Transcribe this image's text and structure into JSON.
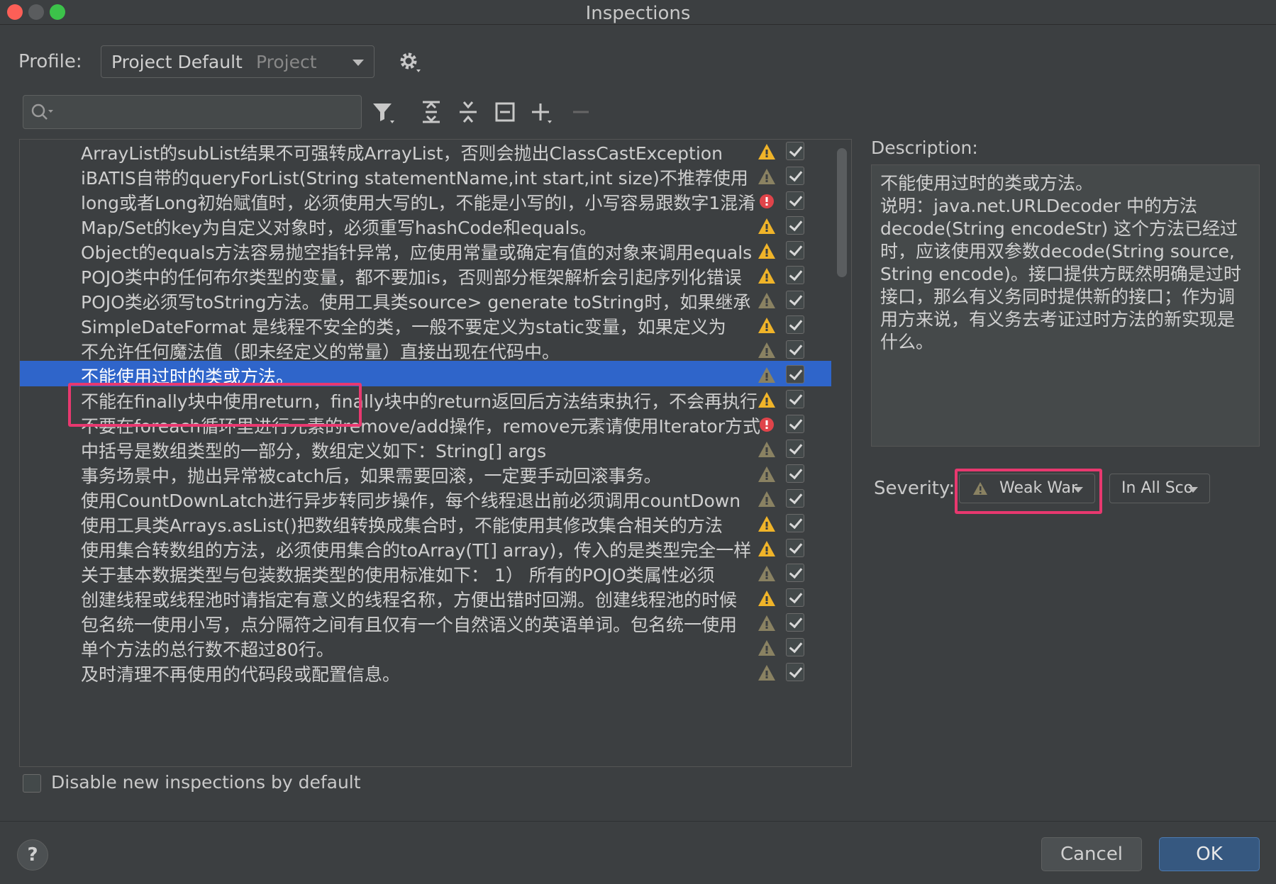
{
  "window": {
    "title": "Inspections"
  },
  "profile": {
    "label": "Profile:",
    "value": "Project Default",
    "scope": "Project"
  },
  "search": {
    "placeholder": ""
  },
  "inspections": [
    {
      "text": "ArrayList的subList结果不可强转成ArrayList，否则会抛出ClassCastException",
      "severity": "warning",
      "checked": true
    },
    {
      "text": "iBATIS自带的queryForList(String statementName,int start,int size)不推荐使用",
      "severity": "weak-warning",
      "checked": true
    },
    {
      "text": "long或者Long初始赋值时，必须使用大写的L，不能是小写的l，小写容易跟数字1混淆",
      "severity": "error",
      "checked": true
    },
    {
      "text": "Map/Set的key为自定义对象时，必须重写hashCode和equals。",
      "severity": "warning",
      "checked": true
    },
    {
      "text": "Object的equals方法容易抛空指针异常，应使用常量或确定有值的对象来调用equals",
      "severity": "warning",
      "checked": true
    },
    {
      "text": "POJO类中的任何布尔类型的变量，都不要加is，否则部分框架解析会引起序列化错误",
      "severity": "warning",
      "checked": true
    },
    {
      "text": "POJO类必须写toString方法。使用工具类source> generate toString时，如果继承",
      "severity": "weak-warning",
      "checked": true
    },
    {
      "text": "SimpleDateFormat 是线程不安全的类，一般不要定义为static变量，如果定义为",
      "severity": "warning",
      "checked": true
    },
    {
      "text": "不允许任何魔法值（即未经定义的常量）直接出现在代码中。",
      "severity": "weak-warning",
      "checked": true
    },
    {
      "text": "不能使用过时的类或方法。",
      "severity": "weak-warning",
      "checked": true,
      "selected": true
    },
    {
      "text": "不能在finally块中使用return，finally块中的return返回后方法结束执行，不会再执行",
      "severity": "warning",
      "checked": true
    },
    {
      "text": "不要在foreach循环里进行元素的remove/add操作，remove元素请使用Iterator方式",
      "severity": "error",
      "checked": true
    },
    {
      "text": "中括号是数组类型的一部分，数组定义如下：String[] args",
      "severity": "weak-warning",
      "checked": true
    },
    {
      "text": "事务场景中，抛出异常被catch后，如果需要回滚，一定要手动回滚事务。",
      "severity": "weak-warning",
      "checked": true
    },
    {
      "text": "使用CountDownLatch进行异步转同步操作，每个线程退出前必须调用countDown",
      "severity": "weak-warning",
      "checked": true
    },
    {
      "text": "使用工具类Arrays.asList()把数组转换成集合时，不能使用其修改集合相关的方法",
      "severity": "warning",
      "checked": true
    },
    {
      "text": "使用集合转数组的方法，必须使用集合的toArray(T[] array)，传入的是类型完全一样",
      "severity": "warning",
      "checked": true
    },
    {
      "text": "关于基本数据类型与包装数据类型的使用标准如下：    1） 所有的POJO类属性必须",
      "severity": "weak-warning",
      "checked": true
    },
    {
      "text": "创建线程或线程池时请指定有意义的线程名称，方便出错时回溯。创建线程池的时候",
      "severity": "warning",
      "checked": true
    },
    {
      "text": "包名统一使用小写，点分隔符之间有且仅有一个自然语义的英语单词。包名统一使用",
      "severity": "weak-warning",
      "checked": true
    },
    {
      "text": "单个方法的总行数不超过80行。",
      "severity": "weak-warning",
      "checked": true
    },
    {
      "text": "及时清理不再使用的代码段或配置信息。",
      "severity": "weak-warning",
      "checked": true
    }
  ],
  "disable_new": {
    "label": "Disable new inspections by default",
    "checked": false
  },
  "description": {
    "label": "Description:",
    "text": "不能使用过时的类或方法。\n说明：java.net.URLDecoder 中的方法decode(String encodeStr) 这个方法已经过时，应该使用双参数decode(String source, String encode)。接口提供方既然明确是过时接口，那么有义务同时提供新的接口；作为调用方来说，有义务去考证过时方法的新实现是什么。"
  },
  "severity": {
    "label": "Severity:",
    "value": "Weak Warning",
    "scope": "In All Scopes"
  },
  "buttons": {
    "help": "?",
    "cancel": "Cancel",
    "ok": "OK"
  },
  "colors": {
    "selection": "#2f65ca",
    "warning": "#f0b429",
    "weak_warning": "#8a8262",
    "error": "#e0444a",
    "highlight": "#e8386f",
    "ok_button": "#365880"
  }
}
